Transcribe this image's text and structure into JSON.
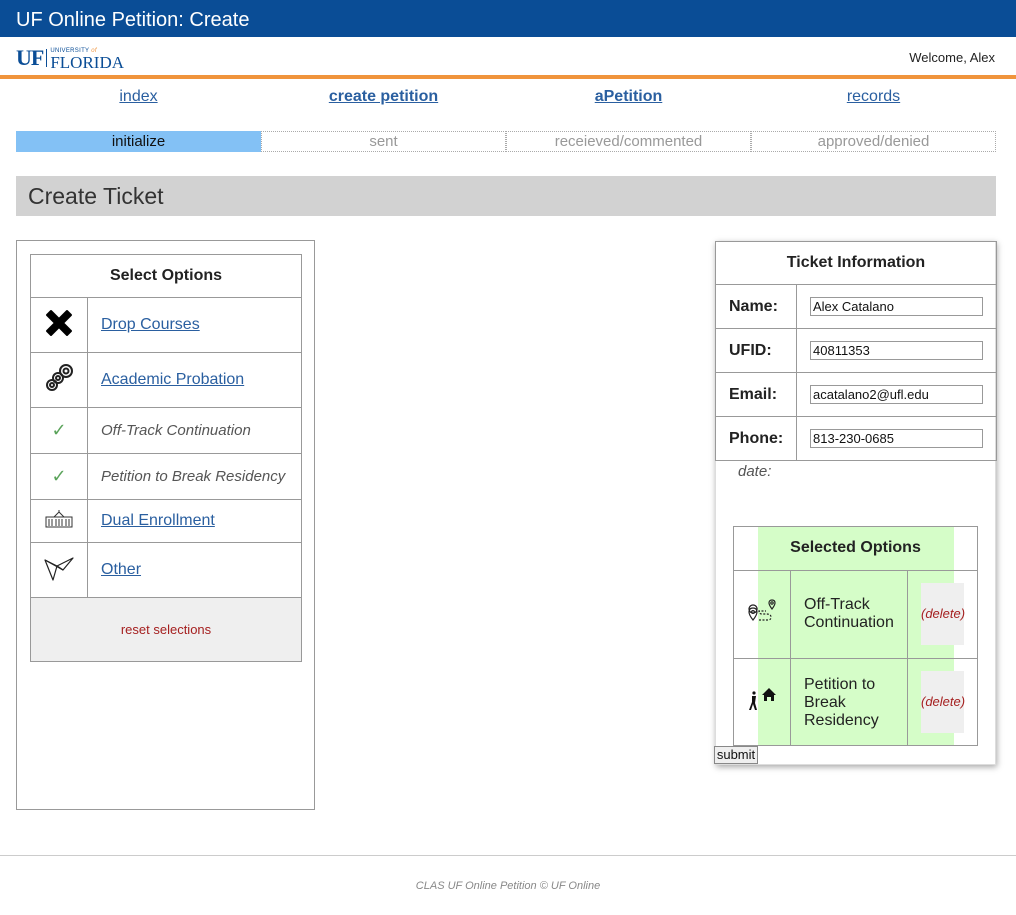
{
  "app": {
    "title": "UF Online Petition: Create"
  },
  "header": {
    "logo_uf": "UF",
    "logo_university": "UNIVERSITY",
    "logo_of": "of",
    "logo_florida": "FLORIDA",
    "welcome": "Welcome, Alex",
    "accent_color": "#f0943c",
    "brand_color": "#0a4d96"
  },
  "nav": {
    "index": "index",
    "create": "create petition",
    "apetition": "aPetition",
    "records": "records"
  },
  "steps": {
    "s1": "initialize",
    "s2": "sent",
    "s3": "receieved/commented",
    "s4": "approved/denied",
    "active": "initialize"
  },
  "page": {
    "heading": "Create Ticket"
  },
  "options": {
    "header": "Select Options",
    "items": [
      {
        "label": "Drop Courses",
        "icon": "x-mark-icon",
        "selected": false
      },
      {
        "label": "Academic Probation",
        "icon": "chain-links-icon",
        "selected": false
      },
      {
        "label": "Off-Track Continuation",
        "icon": "check-icon",
        "selected": true
      },
      {
        "label": "Petition to Break Residency",
        "icon": "check-icon",
        "selected": true
      },
      {
        "label": "Dual Enrollment",
        "icon": "building-icon",
        "selected": false
      },
      {
        "label": "Other",
        "icon": "paper-bird-icon",
        "selected": false
      }
    ],
    "reset": "reset selections"
  },
  "ticket": {
    "header": "Ticket Information",
    "name_label": "Name:",
    "name_value": "Alex Catalano",
    "ufid_label": "UFID:",
    "ufid_value": "40811353",
    "email_label": "Email:",
    "email_value": "acatalano2@ufl.edu",
    "phone_label": "Phone:",
    "phone_value": "813-230-0685",
    "date_label": "date:"
  },
  "selected": {
    "header": "Selected Options",
    "items": [
      {
        "label": "Off-Track Continuation",
        "icon": "route-pin-icon",
        "delete": "(delete)"
      },
      {
        "label": "Petition to Break Residency",
        "icon": "walker-home-icon",
        "delete": "(delete)"
      }
    ],
    "highlight_color": "#d5fdc8"
  },
  "submit": "submit",
  "footer": "CLAS UF Online Petition © UF Online"
}
